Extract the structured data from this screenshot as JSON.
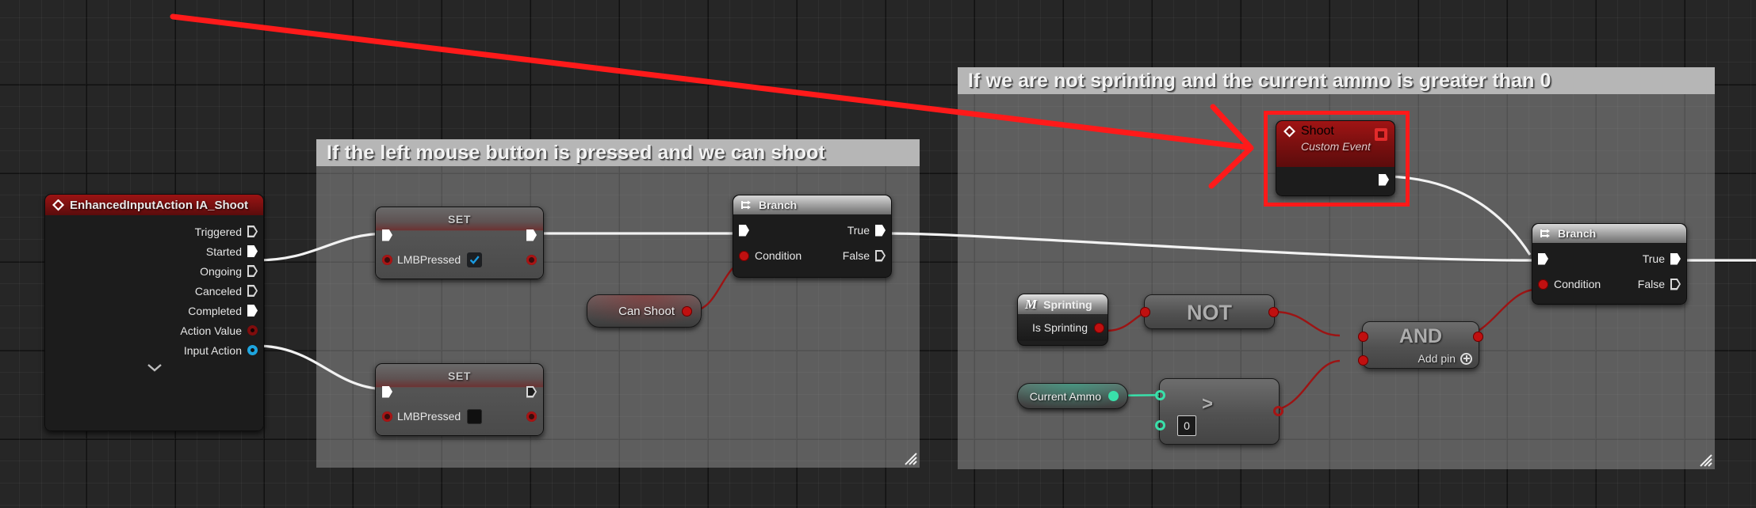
{
  "app": {
    "title": "Unreal Engine Blueprint Event Graph",
    "background_color": "#262626",
    "grid_line_color": "#333333"
  },
  "comments": [
    {
      "id": "comment-left",
      "text": "If the left mouse button is pressed and we can shoot",
      "header_color": "#b6b6b6",
      "body_color": "#acacac"
    },
    {
      "id": "comment-right",
      "text": "If we are not sprinting and the current ammo is greater than 0",
      "header_color": "#b6b6b6",
      "body_color": "#acacac"
    }
  ],
  "nodes": {
    "input_action": {
      "title": "EnhancedInputAction IA_Shoot",
      "header_color": "#7c1010",
      "icon": "event-diamond-icon",
      "pins": [
        {
          "label": "Triggered",
          "type": "exec",
          "state": "unconnected"
        },
        {
          "label": "Started",
          "type": "exec",
          "state": "connected"
        },
        {
          "label": "Ongoing",
          "type": "exec",
          "state": "unconnected"
        },
        {
          "label": "Canceled",
          "type": "exec",
          "state": "unconnected"
        },
        {
          "label": "Completed",
          "type": "exec",
          "state": "connected"
        },
        {
          "label": "Action Value",
          "type": "data",
          "color": "#7e0d0d"
        },
        {
          "label": "Input Action",
          "type": "data",
          "color": "#1ea5de"
        }
      ],
      "expander": "chevron-down-icon"
    },
    "set_true": {
      "title": "SET",
      "variable": "LMBPressed",
      "value": "true",
      "checkbox_checked": true,
      "exec_in_connected": true,
      "exec_out_connected": true
    },
    "set_false": {
      "title": "SET",
      "variable": "LMBPressed",
      "value": "false",
      "checkbox_checked": false,
      "exec_in_connected": true,
      "exec_out_connected": false
    },
    "can_shoot": {
      "label": "Can Shoot",
      "type": "boolean-variable-get",
      "pin_color": "#c01010"
    },
    "branch_left": {
      "title": "Branch",
      "icon": "branch-icon",
      "in_label": "",
      "condition_label": "Condition",
      "true_label": "True",
      "false_label": "False",
      "true_connected": true,
      "false_connected": false
    },
    "shoot_event": {
      "title": "Shoot",
      "subtitle": "Custom Event",
      "icon": "event-diamond-icon",
      "badge": "stop-square-icon",
      "highlighted": true,
      "highlight_color": "#ff1a1a"
    },
    "sprinting": {
      "title": "Sprinting",
      "icon": "macro-m-icon",
      "output_label": "Is Sprinting",
      "pin_color": "#c01010"
    },
    "not_node": {
      "label": "NOT",
      "type": "pure-function"
    },
    "and_node": {
      "label": "AND",
      "add_pin_label": "Add pin",
      "add_pin_icon": "plus-circle-icon",
      "type": "pure-function"
    },
    "current_ammo": {
      "label": "Current Ammo",
      "type": "integer-variable-get",
      "pin_color": "#39e0aa"
    },
    "greater_than": {
      "label": ">",
      "input_b_value": "0",
      "type": "pure-function"
    },
    "branch_right": {
      "title": "Branch",
      "icon": "branch-icon",
      "condition_label": "Condition",
      "true_label": "True",
      "false_label": "False",
      "true_connected": true,
      "false_connected": false
    }
  },
  "annotation": {
    "type": "arrow",
    "color": "#ff1a1a",
    "description": "red arrow pointing to the Shoot custom event node"
  }
}
